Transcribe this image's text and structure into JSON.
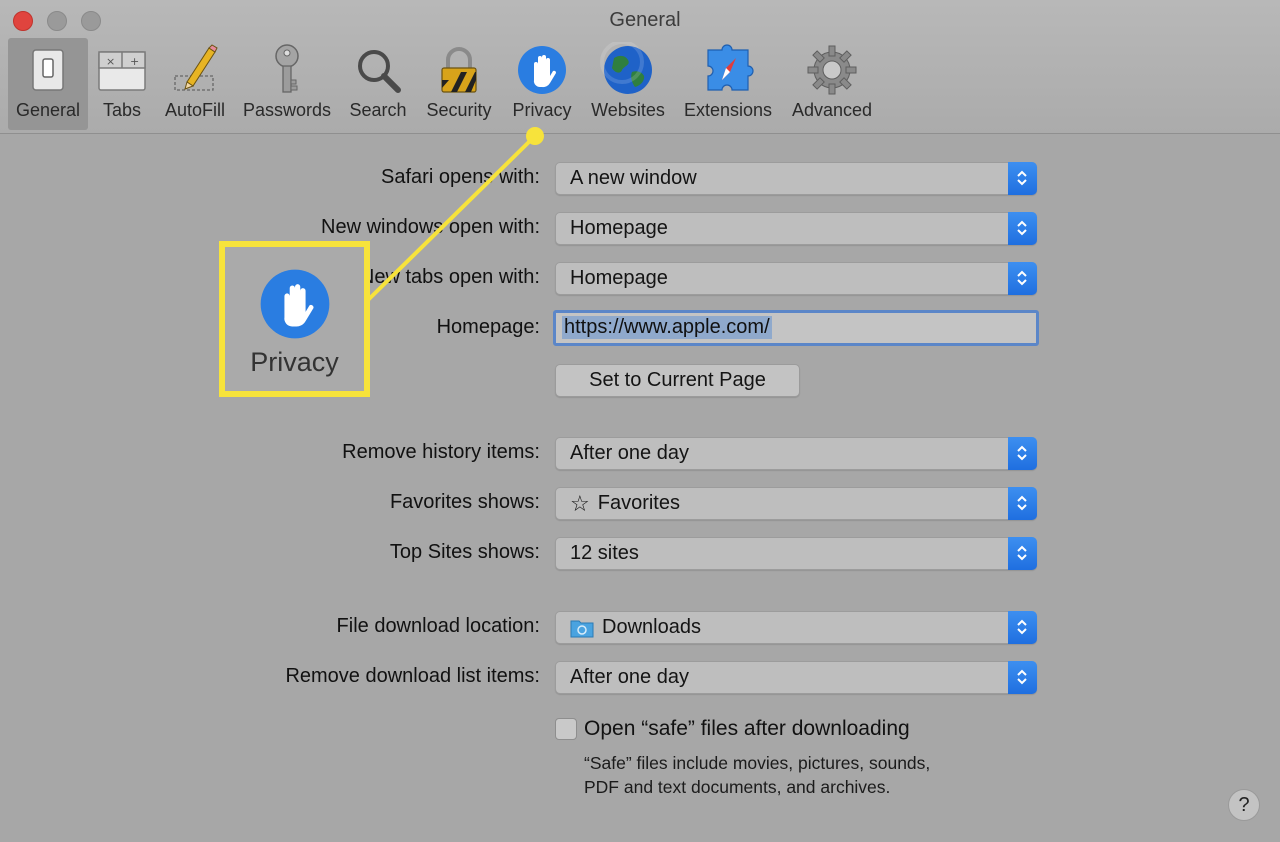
{
  "window": {
    "title": "General"
  },
  "toolbar": {
    "items": [
      {
        "label": "General",
        "icon": "general-switch-icon"
      },
      {
        "label": "Tabs",
        "icon": "tabs-icon"
      },
      {
        "label": "AutoFill",
        "icon": "pencil-icon"
      },
      {
        "label": "Passwords",
        "icon": "key-icon"
      },
      {
        "label": "Search",
        "icon": "magnifier-icon"
      },
      {
        "label": "Security",
        "icon": "padlock-icon"
      },
      {
        "label": "Privacy",
        "icon": "hand-icon"
      },
      {
        "label": "Websites",
        "icon": "globe-icon"
      },
      {
        "label": "Extensions",
        "icon": "puzzle-compass-icon"
      },
      {
        "label": "Advanced",
        "icon": "gear-icon"
      }
    ],
    "selected": "General"
  },
  "form": {
    "safari_opens": {
      "label": "Safari opens with:",
      "value": "A new window"
    },
    "new_windows": {
      "label": "New windows open with:",
      "value": "Homepage"
    },
    "new_tabs": {
      "label": "New tabs open with:",
      "value": "Homepage"
    },
    "homepage": {
      "label": "Homepage:",
      "value": "https://www.apple.com/"
    },
    "set_current": {
      "label": "Set to Current Page"
    },
    "remove_history": {
      "label": "Remove history items:",
      "value": "After one day"
    },
    "favorites": {
      "label": "Favorites shows:",
      "value": "Favorites"
    },
    "top_sites": {
      "label": "Top Sites shows:",
      "value": "12 sites"
    },
    "download_location": {
      "label": "File download location:",
      "value": "Downloads"
    },
    "remove_downloads": {
      "label": "Remove download list items:",
      "value": "After one day"
    },
    "open_safe": {
      "label": "Open “safe” files after downloading",
      "checked": false,
      "note": "“Safe” files include movies, pictures, sounds, PDF and text documents, and archives."
    }
  },
  "help": {
    "label": "?"
  },
  "callout": {
    "label": "Privacy",
    "icon": "hand-icon",
    "color": "#f7e33b"
  },
  "colors": {
    "accent": "#2a7de1",
    "highlight": "#f7e33b"
  }
}
